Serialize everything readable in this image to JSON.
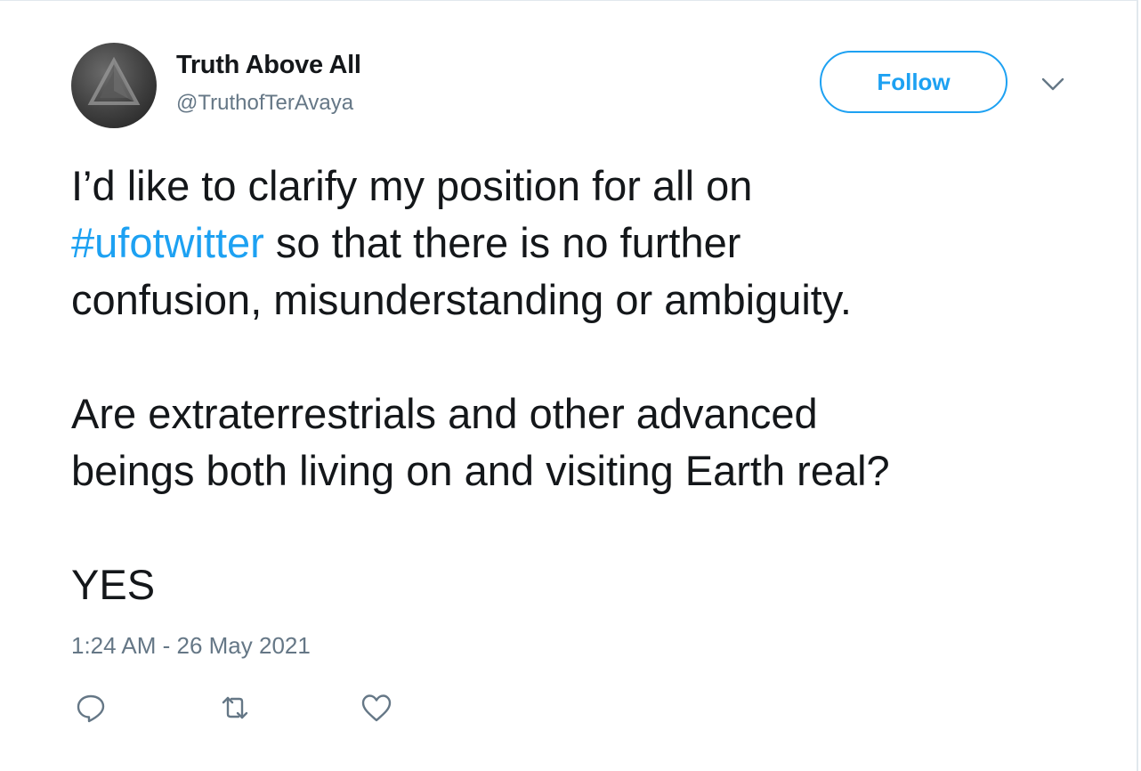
{
  "user": {
    "display_name": "Truth Above All",
    "handle": "@TruthofTerAvaya",
    "avatar_icon": "triangle-avatar-image"
  },
  "follow_button": {
    "label": "Follow"
  },
  "menu": {
    "icon": "chevron-down-icon"
  },
  "tweet": {
    "line1": "I’d like to clarify my position for all on",
    "hashtag": "#ufotwitter",
    "line2_rest": " so that there is no further",
    "line3": "confusion, misunderstanding or ambiguity.",
    "line4": "Are extraterrestrials and other advanced",
    "line5": "beings both living on and visiting Earth real?",
    "line6": "YES"
  },
  "timestamp": "1:24 AM - 26 May 2021",
  "actions": [
    {
      "icon": "reply-icon"
    },
    {
      "icon": "retweet-icon"
    },
    {
      "icon": "like-icon"
    }
  ],
  "colors": {
    "accent": "#1da1f2",
    "text": "#14171a",
    "secondary": "#657786"
  }
}
